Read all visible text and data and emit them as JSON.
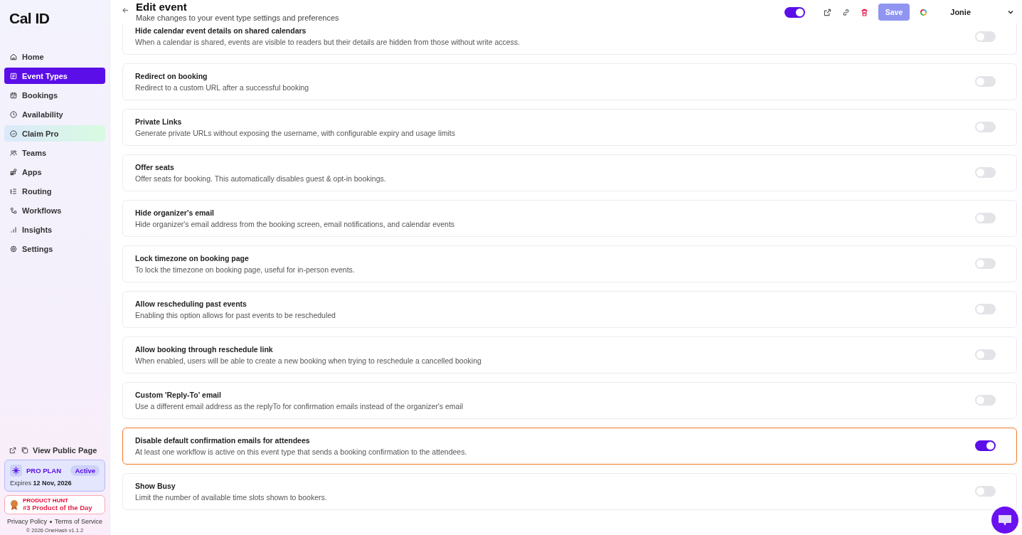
{
  "sidebar": {
    "logo": "Cal ID",
    "items": [
      {
        "label": "Home",
        "selected": false,
        "kind": "normal"
      },
      {
        "label": "Event Types",
        "selected": true,
        "kind": "normal"
      },
      {
        "label": "Bookings",
        "selected": false,
        "kind": "normal"
      },
      {
        "label": "Availability",
        "selected": false,
        "kind": "normal"
      },
      {
        "label": "Claim Pro",
        "selected": false,
        "kind": "promo"
      },
      {
        "label": "Teams",
        "selected": false,
        "kind": "normal"
      },
      {
        "label": "Apps",
        "selected": false,
        "kind": "normal"
      },
      {
        "label": "Routing",
        "selected": false,
        "kind": "normal"
      },
      {
        "label": "Workflows",
        "selected": false,
        "kind": "normal"
      },
      {
        "label": "Insights",
        "selected": false,
        "kind": "normal"
      },
      {
        "label": "Settings",
        "selected": false,
        "kind": "normal"
      }
    ],
    "view_public_page": "View Public Page",
    "plan": {
      "name": "PRO PLAN",
      "status": "Active",
      "expires_label": "Expires",
      "expires_date": "12 Nov, 2026"
    },
    "product_hunt": {
      "eyebrow": "PRODUCT HUNT",
      "title": "#3 Product of the Day"
    },
    "links": [
      "Privacy Policy",
      "Terms of Service"
    ],
    "copyright": "© 2026 OneHash v1.1.2"
  },
  "header": {
    "title": "Edit event",
    "subtitle": "Make changes to your event type settings and preferences",
    "enabled": true,
    "save": "Save",
    "save_disabled": true,
    "user": "Jonie"
  },
  "settings": [
    {
      "title": "Hide calendar event details on shared calendars",
      "description": "When a calendar is shared, events are visible to readers but their details are hidden from those without write access.",
      "on": false,
      "highlighted": false
    },
    {
      "title": "Redirect on booking",
      "description": "Redirect to a custom URL after a successful booking",
      "on": false,
      "highlighted": false
    },
    {
      "title": "Private Links",
      "description": "Generate private URLs without exposing the username, with configurable expiry and usage limits",
      "on": false,
      "highlighted": false
    },
    {
      "title": "Offer seats",
      "description": "Offer seats for booking. This automatically disables guest & opt-in bookings.",
      "on": false,
      "highlighted": false
    },
    {
      "title": "Hide organizer's email",
      "description": "Hide organizer's email address from the booking screen, email notifications, and calendar events",
      "on": false,
      "highlighted": false
    },
    {
      "title": "Lock timezone on booking page",
      "description": "To lock the timezone on booking page, useful for in-person events.",
      "on": false,
      "highlighted": false
    },
    {
      "title": "Allow rescheduling past events",
      "description": "Enabling this option allows for past events to be rescheduled",
      "on": false,
      "highlighted": false
    },
    {
      "title": "Allow booking through reschedule link",
      "description": "When enabled, users will be able to create a new booking when trying to reschedule a cancelled booking",
      "on": false,
      "highlighted": false
    },
    {
      "title": "Custom 'Reply-To' email",
      "description": "Use a different email address as the replyTo for confirmation emails instead of the organizer's email",
      "on": false,
      "highlighted": false
    },
    {
      "title": "Disable default confirmation emails for attendees",
      "description": "At least one workflow is active on this event type that sends a booking confirmation to the attendees.",
      "on": true,
      "highlighted": true
    },
    {
      "title": "Show Busy",
      "description": "Limit the number of available time slots shown to bookers.",
      "on": false,
      "highlighted": false
    }
  ]
}
